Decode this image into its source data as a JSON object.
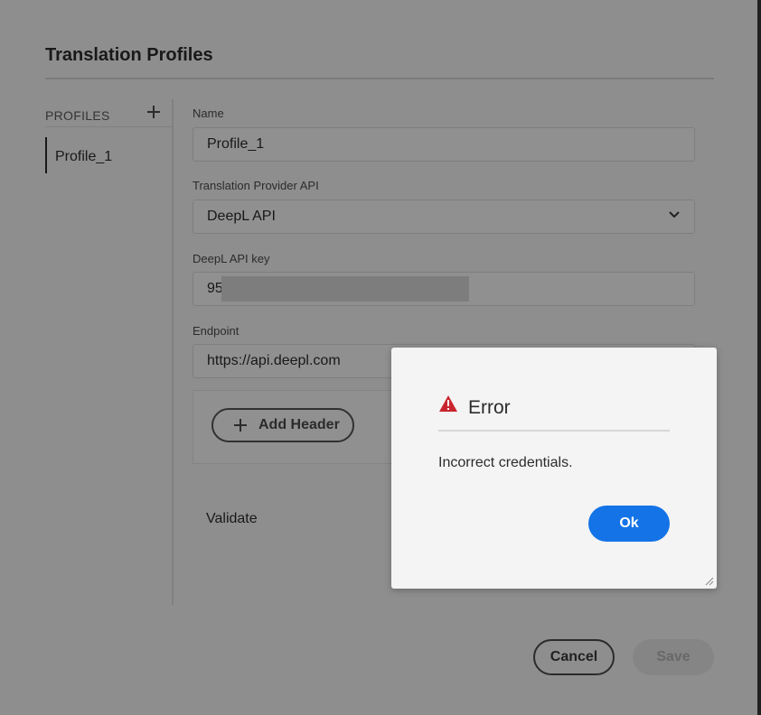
{
  "dialog_title": "Translation Profiles",
  "sidebar": {
    "heading": "PROFILES",
    "add_icon": "plus-icon",
    "items": [
      {
        "label": "Profile_1",
        "selected": true
      }
    ]
  },
  "form": {
    "name": {
      "label": "Name",
      "value": "Profile_1"
    },
    "provider": {
      "label": "Translation Provider API",
      "value": "DeepL API",
      "icon": "chevron-down-icon"
    },
    "api_key": {
      "label": "DeepL API key",
      "value": "95"
    },
    "endpoint": {
      "label": "Endpoint",
      "value": "https://api.deepl.com"
    },
    "add_header_label": "Add Header",
    "validate_label": "Validate"
  },
  "footer": {
    "cancel_label": "Cancel",
    "save_label": "Save"
  },
  "error_dialog": {
    "title": "Error",
    "icon": "alert-triangle-icon",
    "message": "Incorrect credentials.",
    "ok_label": "Ok"
  },
  "colors": {
    "accent": "#1473e6",
    "error": "#c9252d"
  }
}
